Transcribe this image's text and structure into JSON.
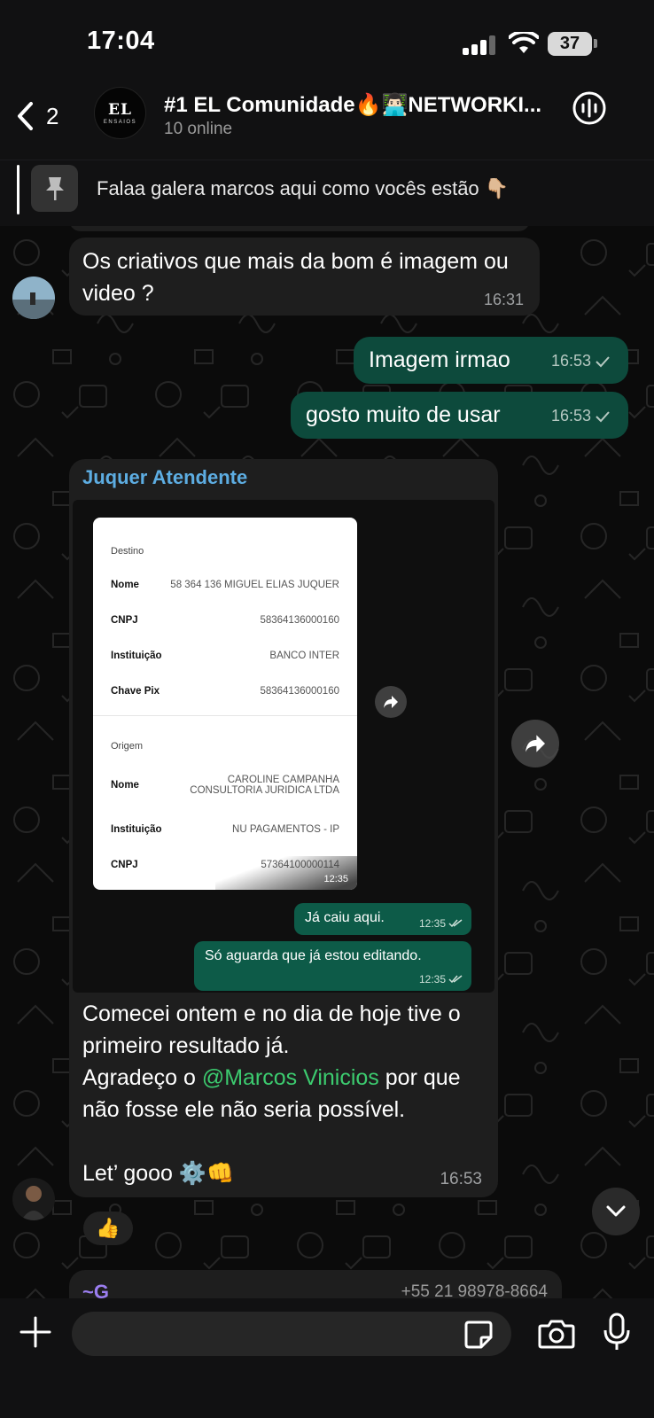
{
  "status_bar": {
    "time": "17:04",
    "battery": "37"
  },
  "header": {
    "back_count": "2",
    "group_logo_main": "EL",
    "group_logo_sub": "ENSAIOS",
    "title": "#1 EL Comunidade🔥👨🏻‍💻NETWORKI...",
    "subtitle": "10 online"
  },
  "pinned": {
    "text": "Falaa galera marcos aqui como vocês estão 👇🏼"
  },
  "messages": [
    {
      "direction": "in",
      "text": "Os criativos que mais da bom é imagem ou video ?",
      "time": "16:31"
    },
    {
      "direction": "out",
      "text": "Imagem irmao",
      "time": "16:53",
      "status": "sent"
    },
    {
      "direction": "out",
      "text": "gosto muito de usar",
      "time": "16:53",
      "status": "sent"
    }
  ],
  "media_message": {
    "sender": "Juquer Atendente",
    "receipt": {
      "destino_label": "Destino",
      "destino": [
        {
          "key": "Nome",
          "value": "58 364 136 MIGUEL ELIAS JUQUER"
        },
        {
          "key": "CNPJ",
          "value": "58364136000160"
        },
        {
          "key": "Instituição",
          "value": "BANCO INTER"
        },
        {
          "key": "Chave Pix",
          "value": "58364136000160"
        }
      ],
      "origem_label": "Origem",
      "origem": [
        {
          "key": "Nome",
          "value": "CAROLINE CAMPANHA CONSULTORIA JURIDICA LTDA"
        },
        {
          "key": "Instituição",
          "value": "NU PAGAMENTOS - IP"
        },
        {
          "key": "CNPJ",
          "value": "57364100000114"
        }
      ],
      "time": "12:35"
    },
    "inner_messages": [
      {
        "text": "Já caiu aqui.",
        "time": "12:35"
      },
      {
        "text": "Só aguarda que já estou editando.",
        "time": "12:35"
      }
    ],
    "caption_line1": "Comecei ontem e no dia de hoje tive o primeiro resultado já.",
    "caption_pre": "Agradeço o ",
    "mention": "@Marcos Vinicios",
    "caption_post": " por que não fosse ele não seria possível.",
    "caption_end": "Let’ gooo ⚙️👊",
    "time": "16:53",
    "reaction": "👍"
  },
  "next_message": {
    "sender": "~G",
    "phone": "+55 21 98978-8664"
  },
  "input": {
    "placeholder": ""
  },
  "colors": {
    "outgoing": "#0d4a3c",
    "incoming": "#1e1e1e",
    "sender_name": "#5dade2",
    "mention": "#3ccb6f"
  }
}
